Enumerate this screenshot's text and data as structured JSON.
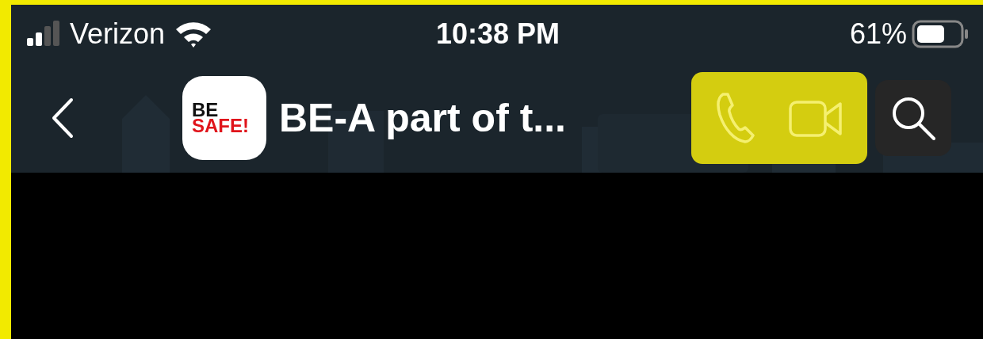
{
  "status_bar": {
    "carrier": "Verizon",
    "time": "10:38 PM",
    "battery": "61%"
  },
  "nav_bar": {
    "logo": {
      "line_1": "BE",
      "line_2": "SAFE!"
    },
    "title": "BE-A part of t...",
    "highlighted_actions": true
  }
}
